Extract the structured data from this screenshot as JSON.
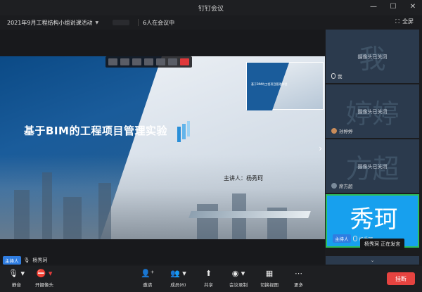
{
  "window": {
    "title": "钉钉会议",
    "minimize": "—",
    "maximize": "☐",
    "close": "✕"
  },
  "meeting": {
    "name": "2021年9月工程结构小组说课活动",
    "participants": "6人在会议中",
    "fullscreen_label": "全屏"
  },
  "slide": {
    "title": "基于BIM的工程项目管理实验",
    "presenter": "主讲人：杨秀珂",
    "pip_title": "基于BIM的工程项目管理实验"
  },
  "speaker_tag": {
    "role": "主持人",
    "name": "杨秀珂"
  },
  "participants": [
    {
      "big": "我",
      "status": "摄像头已关闭",
      "name": "我"
    },
    {
      "big": "婷婷",
      "status": "摄像头已关闭",
      "name": "孙婷婷"
    },
    {
      "big": "方超",
      "status": "摄像头已关闭",
      "name": "席方超"
    },
    {
      "big": "秀珂",
      "role": "主持人",
      "name": "杨秀珂"
    }
  ],
  "speaking_tip": "杨秀珂 正在发言",
  "toolbar": {
    "mute": "静音",
    "camera": "开摄像头",
    "invite": "邀请",
    "members": "成员(6)",
    "share": "共享",
    "record": "会议录制",
    "layout": "切换视图",
    "more": "更多",
    "hangup": "挂断"
  },
  "icons": {
    "mute": "microphone-icon",
    "camera": "camera-off-icon",
    "invite": "add-person-icon",
    "members": "members-icon",
    "share": "share-screen-icon",
    "record": "record-icon",
    "layout": "grid-view-icon",
    "more": "more-dots-icon",
    "fullscreen": "fullscreen-icon"
  },
  "colors": {
    "accent": "#2f7de1",
    "hangup": "#e64340",
    "active_tile": "#17a0ee",
    "speaking_border": "#2ebd5a"
  }
}
